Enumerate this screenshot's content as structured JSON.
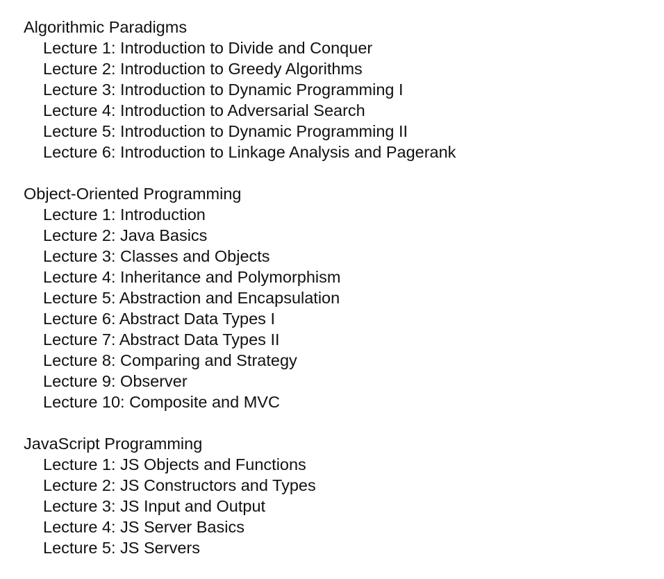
{
  "courses": [
    {
      "title": "Algorithmic Paradigms",
      "lectures": [
        "Lecture 1: Introduction to Divide and Conquer",
        "Lecture 2: Introduction to Greedy Algorithms",
        "Lecture 3: Introduction to Dynamic Programming I",
        "Lecture 4: Introduction to Adversarial Search",
        "Lecture 5: Introduction to Dynamic Programming II",
        "Lecture 6: Introduction to Linkage Analysis and Pagerank"
      ]
    },
    {
      "title": "Object-Oriented Programming",
      "lectures": [
        "Lecture 1: Introduction",
        "Lecture 2: Java Basics",
        "Lecture 3: Classes and Objects",
        "Lecture 4: Inheritance and Polymorphism",
        "Lecture 5: Abstraction and Encapsulation",
        "Lecture 6: Abstract Data Types I",
        "Lecture 7: Abstract Data Types II",
        "Lecture 8: Comparing and Strategy",
        "Lecture 9: Observer",
        "Lecture 10: Composite and MVC"
      ]
    },
    {
      "title": "JavaScript Programming",
      "lectures": [
        "Lecture 1: JS Objects and Functions",
        "Lecture 2: JS Constructors and Types",
        "Lecture 3: JS Input and Output",
        "Lecture 4: JS Server Basics",
        "Lecture 5: JS Servers"
      ]
    }
  ]
}
